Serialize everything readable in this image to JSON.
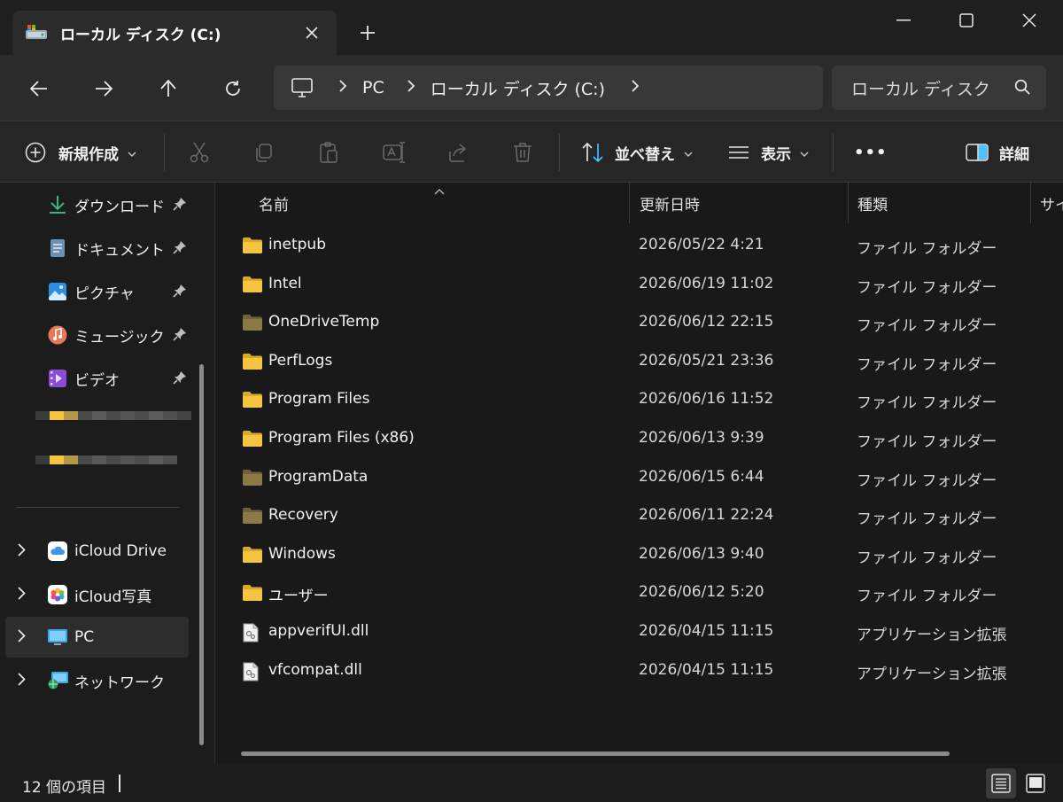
{
  "window": {
    "tab_title": "ローカル ディスク (C:)",
    "new_tab_glyph": "+",
    "icons": [
      "drive-icon",
      "close-icon",
      "plus-icon",
      "minimize-icon",
      "maximize-icon",
      "close-window-icon"
    ]
  },
  "address_bar": {
    "breadcrumbs": [
      "PC",
      "ローカル ディスク (C:)"
    ],
    "search_placeholder": "ローカル ディスク (C:) の検索"
  },
  "toolbar": {
    "new_label": "新規作成",
    "sort_label": "並べ替え",
    "view_label": "表示",
    "more_label": "•••",
    "details_label": "詳細"
  },
  "sidebar": {
    "quick_access": [
      {
        "label": "ダウンロード",
        "icon": "download-icon",
        "pinned": true
      },
      {
        "label": "ドキュメント",
        "icon": "document-icon",
        "pinned": true
      },
      {
        "label": "ピクチャ",
        "icon": "pictures-icon",
        "pinned": true
      },
      {
        "label": "ミュージック",
        "icon": "music-icon",
        "pinned": true
      },
      {
        "label": "ビデオ",
        "icon": "video-icon",
        "pinned": true
      }
    ],
    "locations": [
      {
        "label": "iCloud Drive",
        "icon": "icloud-drive-icon"
      },
      {
        "label": "iCloud写真",
        "icon": "icloud-photos-icon"
      },
      {
        "label": "PC",
        "icon": "pc-icon",
        "selected": true
      },
      {
        "label": "ネットワーク",
        "icon": "network-icon"
      }
    ]
  },
  "columns": {
    "name": "名前",
    "date": "更新日時",
    "type": "種類",
    "size": "サイズ"
  },
  "files": [
    {
      "name": "inetpub",
      "date": "2026/05/22 4:21",
      "type": "ファイル フォルダー",
      "kind": "folder"
    },
    {
      "name": "Intel",
      "date": "2026/06/19 11:02",
      "type": "ファイル フォルダー",
      "kind": "folder"
    },
    {
      "name": "OneDriveTemp",
      "date": "2026/06/12 22:15",
      "type": "ファイル フォルダー",
      "kind": "folder-dim"
    },
    {
      "name": "PerfLogs",
      "date": "2026/05/21 23:36",
      "type": "ファイル フォルダー",
      "kind": "folder"
    },
    {
      "name": "Program Files",
      "date": "2026/06/16 11:52",
      "type": "ファイル フォルダー",
      "kind": "folder"
    },
    {
      "name": "Program Files (x86)",
      "date": "2026/06/13 9:39",
      "type": "ファイル フォルダー",
      "kind": "folder"
    },
    {
      "name": "ProgramData",
      "date": "2026/06/15 6:44",
      "type": "ファイル フォルダー",
      "kind": "folder-dim"
    },
    {
      "name": "Recovery",
      "date": "2026/06/11 22:24",
      "type": "ファイル フォルダー",
      "kind": "folder-dim"
    },
    {
      "name": "Windows",
      "date": "2026/06/13 9:40",
      "type": "ファイル フォルダー",
      "kind": "folder"
    },
    {
      "name": "ユーザー",
      "date": "2026/06/12 5:20",
      "type": "ファイル フォルダー",
      "kind": "folder"
    },
    {
      "name": "appverifUI.dll",
      "date": "2026/04/15 11:15",
      "type": "アプリケーション拡張",
      "kind": "dll"
    },
    {
      "name": "vfcompat.dll",
      "date": "2026/04/15 11:15",
      "type": "アプリケーション拡張",
      "kind": "dll"
    }
  ],
  "status": {
    "item_count": "12 個の項目"
  },
  "colors": {
    "folder": "#f5c542",
    "folder_dim": "#8c7a46",
    "accent": "#4cc2ff"
  }
}
